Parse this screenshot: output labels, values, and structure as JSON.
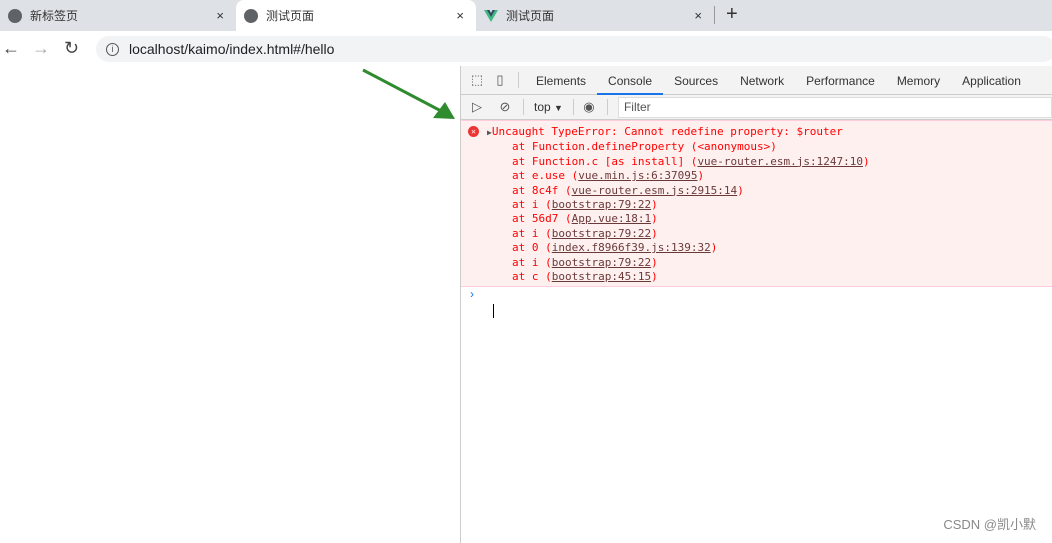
{
  "tabs": [
    {
      "title": "新标签页",
      "icon": "globe-icon"
    },
    {
      "title": "测试页面",
      "icon": "globe-icon",
      "active": true
    },
    {
      "title": "测试页面",
      "icon": "vue-logo-icon"
    }
  ],
  "close_glyph": "×",
  "new_tab_glyph": "+",
  "address": {
    "url": "localhost/kaimo/index.html#/hello"
  },
  "devtools": {
    "tabs": [
      "Elements",
      "Console",
      "Sources",
      "Network",
      "Performance",
      "Memory",
      "Application"
    ],
    "selected_tab": "Console",
    "context": "top",
    "filter_placeholder": "Filter",
    "error": {
      "message": "Uncaught TypeError: Cannot redefine property: $router",
      "frames": [
        {
          "fn": "at Function.defineProperty (",
          "link": "",
          "tail": "<anonymous>)"
        },
        {
          "fn": "at Function.c [as install] (",
          "link": "vue-router.esm.js:1247:10",
          "tail": ")"
        },
        {
          "fn": "at e.use (",
          "link": "vue.min.js:6:37095",
          "tail": ")"
        },
        {
          "fn": "at 8c4f (",
          "link": "vue-router.esm.js:2915:14",
          "tail": ")"
        },
        {
          "fn": "at i (",
          "link": "bootstrap:79:22",
          "tail": ")"
        },
        {
          "fn": "at 56d7 (",
          "link": "App.vue:18:1",
          "tail": ")"
        },
        {
          "fn": "at i (",
          "link": "bootstrap:79:22",
          "tail": ")"
        },
        {
          "fn": "at 0 (",
          "link": "index.f8966f39.js:139:32",
          "tail": ")"
        },
        {
          "fn": "at i (",
          "link": "bootstrap:79:22",
          "tail": ")"
        },
        {
          "fn": "at c (",
          "link": "bootstrap:45:15",
          "tail": ")"
        }
      ]
    },
    "prompt": "›"
  },
  "annotation_color": "#2e8b2e",
  "watermark": "CSDN @凯小默"
}
